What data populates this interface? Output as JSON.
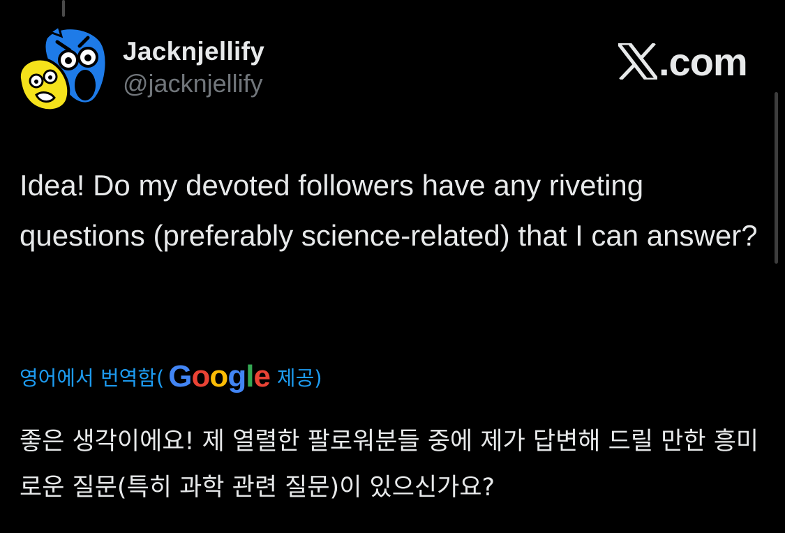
{
  "author": {
    "display_name": "Jacknjellify",
    "handle": "@jacknjellify",
    "avatar_icon": "two-cartoon-faces-avatar"
  },
  "brand": {
    "logo_icon": "x-logo-icon",
    "suffix": ".com"
  },
  "tweet": {
    "text": "Idea! Do my devoted followers have any riveting questions (preferably science-related) that I can answer?"
  },
  "translation": {
    "prefix": "영어에서 번역함(",
    "google_letters": [
      "G",
      "o",
      "o",
      "g",
      "l",
      "e"
    ],
    "suffix": "제공)",
    "text": "좋은 생각이에요! 제 열렬한 팔로워분들 중에 제가 답변해 드릴 만한 흥미로운 질문(특히 과학 관련 질문)이 있으신가요?"
  },
  "colors": {
    "background": "#000000",
    "primary_text": "#e7e9ea",
    "secondary_text": "#71767b",
    "link": "#1d9bf0",
    "google_blue": "#4285f4",
    "google_red": "#ea4335",
    "google_yellow": "#fbbc05",
    "google_green": "#34a853"
  }
}
